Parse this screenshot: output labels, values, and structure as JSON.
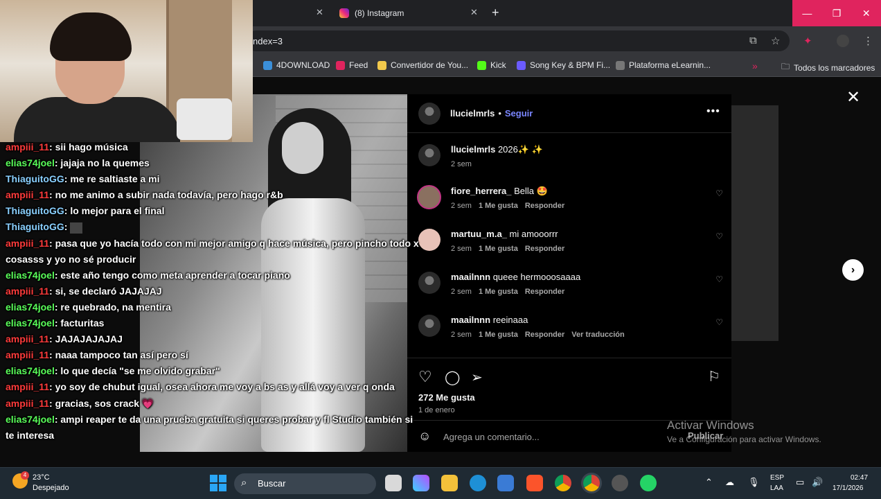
{
  "browser": {
    "tabs": [
      {
        "title": "(8) Instagram"
      }
    ],
    "url_fragment": "ndex=3",
    "bookmarks": [
      {
        "label": "4DOWNLOAD",
        "color": "#3b8fd9"
      },
      {
        "label": "Feed",
        "color": "#e0245e"
      },
      {
        "label": "Convertidor de You...",
        "color": "#f2c94c"
      },
      {
        "label": "Kick",
        "color": "#53fc18"
      },
      {
        "label": "Song Key & BPM Fi...",
        "color": "#6b5bff"
      },
      {
        "label": "Plataforma eLearnin...",
        "color": "#777777"
      }
    ],
    "all_bookmarks_label": "Todos los marcadores"
  },
  "post": {
    "username": "llucielmrls",
    "follow_label": "Seguir",
    "caption_user": "llucielmrls",
    "caption_text": "2026✨ ✨",
    "caption_time": "2 sem",
    "comments": [
      {
        "user": "fiore_herrera_",
        "text": "Bella 🤩",
        "time": "2 sem",
        "likes": "1 Me gusta",
        "reply": "Responder",
        "extra": ""
      },
      {
        "user": "martuu_m.a_",
        "text": "mi amooorrr",
        "time": "2 sem",
        "likes": "1 Me gusta",
        "reply": "Responder",
        "extra": ""
      },
      {
        "user": "maailnnn",
        "text": "queee hermooosaaaa",
        "time": "2 sem",
        "likes": "1 Me gusta",
        "reply": "Responder",
        "extra": ""
      },
      {
        "user": "maailnnn",
        "text": "reeinaaa",
        "time": "2 sem",
        "likes": "1 Me gusta",
        "reply": "Responder",
        "extra": "Ver traducción"
      }
    ],
    "like_count": "272 Me gusta",
    "date": "1 de enero",
    "comment_placeholder": "Agrega un comentario...",
    "publish_label": "Publicar"
  },
  "chat": [
    {
      "user": "ampiii_11",
      "color": "red",
      "msg": "sii hago música"
    },
    {
      "user": "elias74joel",
      "color": "green",
      "msg": "jajaja no la quemes"
    },
    {
      "user": "ThiaguitoGG",
      "color": "blue",
      "msg": "me re saltiaste a mi"
    },
    {
      "user": "ampiii_11",
      "color": "red",
      "msg": "no me animo a subir nada todavía, pero hago r&b"
    },
    {
      "user": "ThiaguitoGG",
      "color": "blue",
      "msg": "lo mejor para el final"
    },
    {
      "user": "ThiaguitoGG",
      "color": "blue",
      "msg": ""
    },
    {
      "user": "ampiii_11",
      "color": "red",
      "msg": "pasa que yo hacía todo con mi mejor amigo q hace música, pero pincho todo x cosasss y yo no sé producir"
    },
    {
      "user": "elias74joel",
      "color": "green",
      "msg": "este año tengo como meta aprender a tocar piano"
    },
    {
      "user": "ampiii_11",
      "color": "red",
      "msg": "si, se declaró JAJAJAJ"
    },
    {
      "user": "elias74joel",
      "color": "green",
      "msg": "re quebrado, na mentira"
    },
    {
      "user": "elias74joel",
      "color": "green",
      "msg": "facturitas"
    },
    {
      "user": "ampiii_11",
      "color": "red",
      "msg": "JAJAJAJAJAJ"
    },
    {
      "user": "ampiii_11",
      "color": "red",
      "msg": "naaa tampoco tan así pero sí"
    },
    {
      "user": "elias74joel",
      "color": "green",
      "msg": "lo que decía \"se me olvido grabar\""
    },
    {
      "user": "ampiii_11",
      "color": "red",
      "msg": "yo soy de chubut igual, osea ahora me voy a bs as y allá voy a ver q onda"
    },
    {
      "user": "ampiii_11",
      "color": "red",
      "msg": "gracias, sos crack 💗"
    },
    {
      "user": "elias74joel",
      "color": "green",
      "msg": "ampi reaper te da una prueba gratuita si queres probar y fl Studio también si te interesa"
    }
  ],
  "watermark": {
    "title": "Activar Windows",
    "subtitle": "Ve a Configuración para activar Windows."
  },
  "taskbar": {
    "temperature": "23°C",
    "condition": "Despejado",
    "weather_badge": "4",
    "search_label": "Buscar",
    "lang_1": "ESP",
    "lang_2": "LAA",
    "time": "02:47",
    "date": "17/1/2026"
  }
}
